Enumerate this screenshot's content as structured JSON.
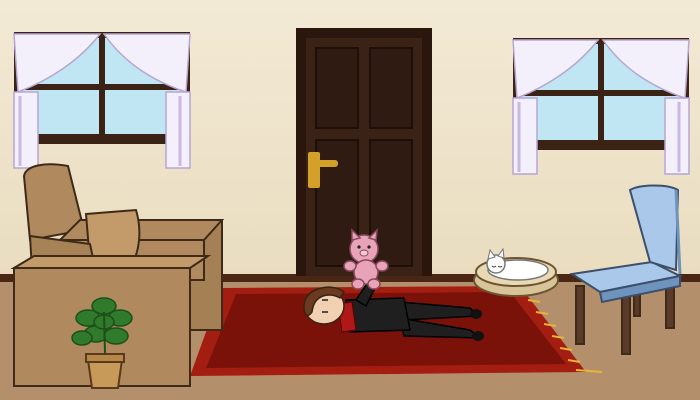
{
  "scene": {
    "colors": {
      "wall_top": "#f3ead6",
      "wall_bottom": "#e9dcbf",
      "floor": "#b48f6c",
      "baseboard": "#4a2614",
      "door": "#3b2216",
      "door_frame": "#2a160c",
      "door_handle": "#d3a12a",
      "window_frame": "#3a2314",
      "window_glass": "#bfe6f2",
      "curtain": "#f4f0fb",
      "curtain_shadow": "#c9b8e2",
      "sofa": "#b08a5e",
      "sofa_dark": "#8b6a45",
      "rug": "#a31d10",
      "rug_inner": "#7b120a",
      "rug_fringe": "#e7b33a",
      "chair": "#a9c8ea",
      "chair_dark": "#6e93bd",
      "chair_legs": "#5a3a28",
      "cat_bed": "#d9c49a",
      "cat": "#ffffff",
      "teddy": "#e8a3b8",
      "plant": "#2f7a2b",
      "pot": "#c89a5a",
      "character_outfit": "#1f1f1f",
      "character_hair": "#6a3b1f",
      "character_skin": "#f2d1b3"
    },
    "objects": [
      "left-window",
      "right-window",
      "front-door",
      "sofa",
      "potted-plant",
      "red-rug",
      "character-lying",
      "pink-teddy-bear",
      "cat-in-bed",
      "blue-chair"
    ]
  }
}
